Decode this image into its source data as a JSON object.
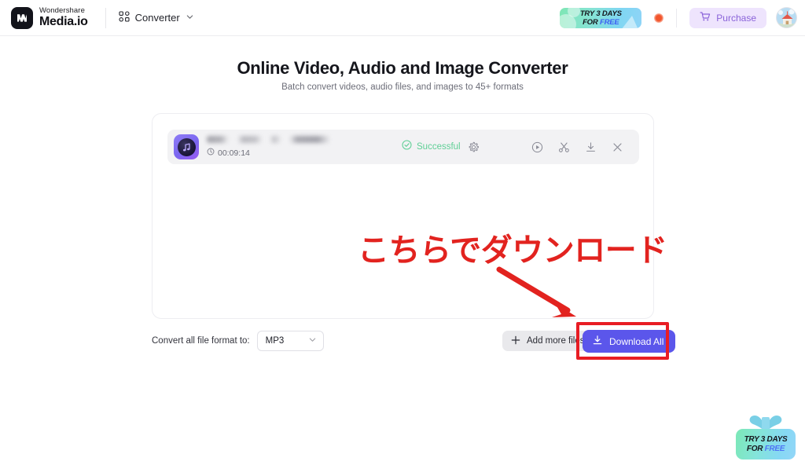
{
  "header": {
    "brand": {
      "top_line": "Wondershare",
      "bottom_line": "Media.io",
      "logo_icon": "wondershare-m-logo"
    },
    "nav": {
      "grid_icon": "apps-grid-icon",
      "label": "Converter",
      "chevron_icon": "chevron-down-icon"
    },
    "promo_pill": {
      "line1": "TRY 3 DAYS",
      "line2_prefix": "FOR ",
      "line2_highlight": "FREE"
    },
    "notification_icon": "notification-dot-icon",
    "purchase": {
      "label": "Purchase",
      "icon": "shopping-cart-icon"
    },
    "avatar_icon": "user-avatar-icon"
  },
  "page": {
    "title": "Online Video, Audio and Image Converter",
    "subtitle": "Batch convert videos, audio files, and images to 45+ formats"
  },
  "file_row": {
    "thumbnail_icon": "music-note-icon",
    "file_name": "",
    "duration": "00:09:14",
    "clock_icon": "clock-icon",
    "status": {
      "label": "Successful",
      "icon": "check-circle-icon",
      "color": "#5fcf96"
    },
    "settings_icon": "gear-icon",
    "actions": [
      {
        "name": "play-circle-icon",
        "label": "Play"
      },
      {
        "name": "scissors-icon",
        "label": "Trim"
      },
      {
        "name": "download-icon",
        "label": "Download"
      },
      {
        "name": "close-icon",
        "label": "Remove"
      }
    ]
  },
  "controls": {
    "format_label": "Convert all file format to:",
    "format_value": "MP3",
    "format_chevron_icon": "chevron-down-icon",
    "add_more": {
      "label": "Add more files",
      "icon": "plus-icon"
    },
    "download_all": {
      "label": "Download All",
      "icon": "download-icon",
      "color": "#5b56eb"
    }
  },
  "annotations": {
    "note_text": "こちらでダウンロード",
    "note_color": "#e2231f",
    "arrow_icon": "arrow-down-right-icon",
    "highlight_box_color": "#e81d24"
  },
  "gift_badge": {
    "line1": "TRY 3 DAYS",
    "line2_prefix": "FOR ",
    "line2_highlight": "FREE",
    "bow_icon": "gift-bow-icon"
  }
}
